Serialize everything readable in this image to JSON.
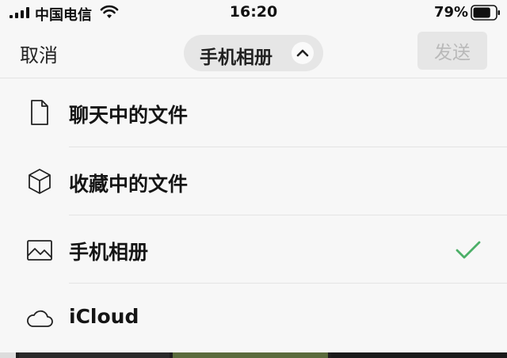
{
  "status_bar": {
    "carrier": "中国电信",
    "time": "16:20",
    "battery_percent": "79%",
    "battery_level": 0.79,
    "icons": [
      "signal-icon",
      "wifi-icon",
      "battery-icon"
    ]
  },
  "nav": {
    "cancel_label": "取消",
    "album_label": "手机相册",
    "album_chevron": "chevron-up-icon",
    "send_label": "发送",
    "send_enabled": false
  },
  "menu": {
    "items": [
      {
        "label": "聊天中的文件",
        "icon": "file-icon",
        "selected": false
      },
      {
        "label": "收藏中的文件",
        "icon": "cube-icon",
        "selected": false
      },
      {
        "label": "手机相册",
        "icon": "image-icon",
        "selected": true
      },
      {
        "label": "iCloud",
        "icon": "cloud-icon",
        "selected": false
      }
    ]
  },
  "colors": {
    "check": "#4caf68",
    "background": "#f7f7f7",
    "switcher_bg": "#e6e6e6",
    "send_disabled_text": "#b9b9b9"
  }
}
